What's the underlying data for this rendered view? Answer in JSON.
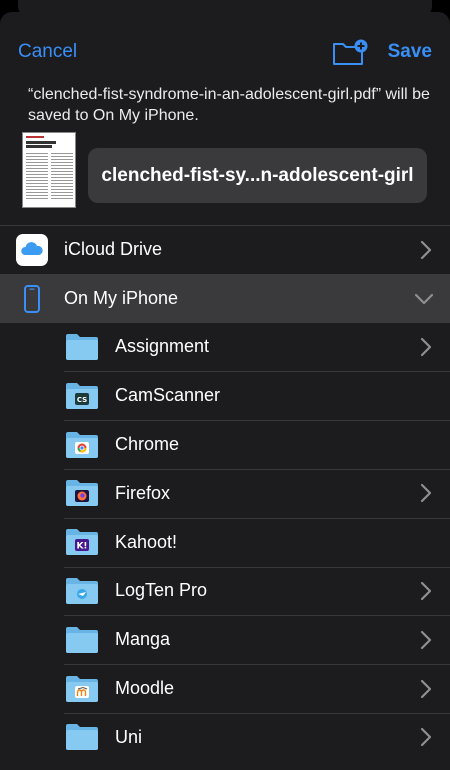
{
  "nav": {
    "cancel_label": "Cancel",
    "save_label": "Save"
  },
  "message": "“clenched-fist-syndrome-in-an-adolescent-girl.pdf” will be saved to On My iPhone.",
  "filename": "clenched-fist-sy...n-adolescent-girl",
  "locations": [
    {
      "label": "iCloud Drive",
      "icon": "icloud-drive-icon",
      "state": "collapsed"
    },
    {
      "label": "On My iPhone",
      "icon": "iphone-icon",
      "state": "expanded"
    }
  ],
  "folders": [
    {
      "label": "Assignment",
      "badge": null,
      "has_chevron": true
    },
    {
      "label": "CamScanner",
      "badge": "camscanner-badge-icon",
      "has_chevron": false
    },
    {
      "label": "Chrome",
      "badge": "chrome-badge-icon",
      "has_chevron": false
    },
    {
      "label": "Firefox",
      "badge": "firefox-badge-icon",
      "has_chevron": true
    },
    {
      "label": "Kahoot!",
      "badge": "kahoot-badge-icon",
      "has_chevron": false
    },
    {
      "label": "LogTen Pro",
      "badge": "logten-badge-icon",
      "has_chevron": true
    },
    {
      "label": "Manga",
      "badge": null,
      "has_chevron": true
    },
    {
      "label": "Moodle",
      "badge": "moodle-badge-icon",
      "has_chevron": true
    },
    {
      "label": "Uni",
      "badge": null,
      "has_chevron": true
    }
  ],
  "colors": {
    "accent": "#3a8ff7",
    "folder": "#7fc4ee",
    "background": "#1c1c1e"
  }
}
